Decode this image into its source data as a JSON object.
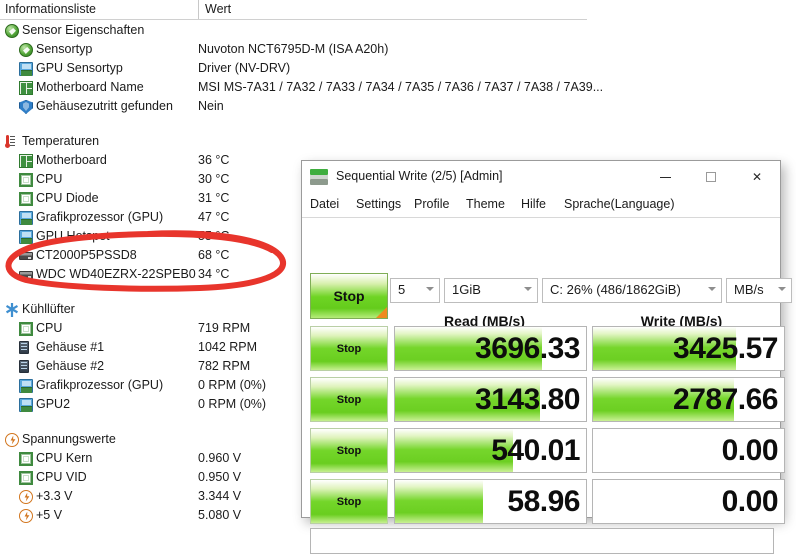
{
  "sensor_panel": {
    "header": {
      "col_name": "Informationsliste",
      "col_value": "Wert"
    },
    "groups": [
      {
        "label": "Sensor Eigenschaften",
        "icon": "globe-icon",
        "rows": [
          {
            "label": "Sensortyp",
            "value": "Nuvoton NCT6795D-M  (ISA A20h)",
            "icon": "globe-icon"
          },
          {
            "label": "GPU Sensortyp",
            "value": "Driver  (NV-DRV)",
            "icon": "monitor-icon"
          },
          {
            "label": "Motherboard Name",
            "value": "MSI MS-7A31 / 7A32 / 7A33 / 7A34 / 7A35 / 7A36 / 7A37 / 7A38 / 7A39...",
            "icon": "motherboard-icon"
          },
          {
            "label": "Gehäusezutritt gefunden",
            "value": "Nein",
            "icon": "shield-icon"
          }
        ]
      },
      {
        "label": "Temperaturen",
        "icon": "thermometer-icon",
        "rows": [
          {
            "label": "Motherboard",
            "value": "36 °C",
            "icon": "motherboard-icon"
          },
          {
            "label": "CPU",
            "value": "30 °C",
            "icon": "cpu-icon"
          },
          {
            "label": "CPU Diode",
            "value": "31 °C",
            "icon": "cpu-icon"
          },
          {
            "label": "Grafikprozessor (GPU)",
            "value": "47 °C",
            "icon": "monitor-icon"
          },
          {
            "label": "GPU Hotspot",
            "value": "55 °C",
            "icon": "monitor-icon"
          },
          {
            "label": "CT2000P5PSSD8",
            "value": "68 °C",
            "icon": "drive-icon"
          },
          {
            "label": "WDC WD40EZRX-22SPEB0",
            "value": "34 °C",
            "icon": "drive-icon"
          }
        ]
      },
      {
        "label": "Kühllüfter",
        "icon": "fan-icon",
        "rows": [
          {
            "label": "CPU",
            "value": "719 RPM",
            "icon": "cpu-icon"
          },
          {
            "label": "Gehäuse #1",
            "value": "1042 RPM",
            "icon": "case-icon"
          },
          {
            "label": "Gehäuse #2",
            "value": "782 RPM",
            "icon": "case-icon"
          },
          {
            "label": "Grafikprozessor (GPU)",
            "value": "0 RPM  (0%)",
            "icon": "monitor-icon"
          },
          {
            "label": "GPU2",
            "value": "0 RPM  (0%)",
            "icon": "monitor-icon"
          }
        ]
      },
      {
        "label": "Spannungswerte",
        "icon": "bolt-icon",
        "rows": [
          {
            "label": "CPU Kern",
            "value": "0.960 V",
            "icon": "cpu-icon"
          },
          {
            "label": "CPU VID",
            "value": "0.950 V",
            "icon": "cpu-icon"
          },
          {
            "label": "+3.3 V",
            "value": "3.344 V",
            "icon": "bolt-icon"
          },
          {
            "label": "+5 V",
            "value": "5.080 V",
            "icon": "bolt-icon"
          }
        ]
      }
    ],
    "annotation": {
      "shape": "hand-drawn-ellipse",
      "color": "#e8352c",
      "highlights": [
        "CT2000P5PSSD8",
        "68 °C"
      ]
    }
  },
  "cdm_window": {
    "title": "Sequential Write (2/5) [Admin]",
    "app_icon": "disk-drive-icon",
    "window_buttons": {
      "minimize": "minimize-icon",
      "maximize": "maximize-icon",
      "close": "close-icon"
    },
    "menu": [
      "Datei",
      "Settings",
      "Profile",
      "Theme",
      "Hilfe",
      "Sprache(Language)"
    ],
    "toolbar": {
      "main_button_label": "Stop",
      "test_count": "5",
      "test_size": "1GiB",
      "target_drive": "C: 26% (486/1862GiB)",
      "unit": "MB/s"
    },
    "columns": {
      "read": "Read (MB/s)",
      "write": "Write (MB/s)"
    },
    "rows": [
      {
        "button_label": "Stop",
        "read": "3696.33",
        "write": "3425.57",
        "read_bar_pct": 77,
        "write_bar_pct": 75
      },
      {
        "button_label": "Stop",
        "read": "3143.80",
        "write": "2787.66",
        "read_bar_pct": 76,
        "write_bar_pct": 74
      },
      {
        "button_label": "Stop",
        "read": "540.01",
        "write": "0.00",
        "read_bar_pct": 62,
        "write_bar_pct": 0
      },
      {
        "button_label": "Stop",
        "read": "58.96",
        "write": "0.00",
        "read_bar_pct": 46,
        "write_bar_pct": 0
      }
    ],
    "status_text": ""
  },
  "colors": {
    "accent_green": "#6fd424",
    "annotation_red": "#e8352c",
    "corner_orange": "#f08a1e"
  }
}
